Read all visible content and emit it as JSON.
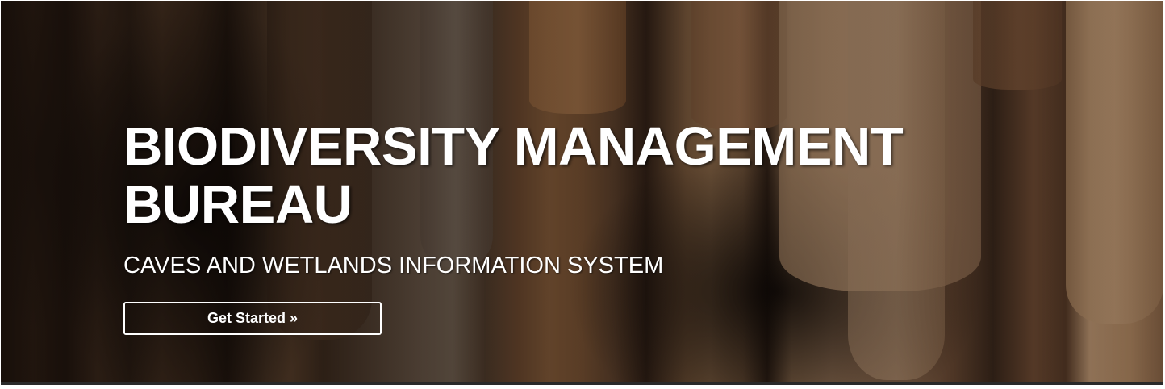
{
  "hero": {
    "title": "BIODIVERSITY MANAGEMENT BUREAU",
    "subtitle": "CAVES AND WETLANDS INFORMATION SYSTEM",
    "cta_label": "Get Started »",
    "background_image": "cave-stalactites-photo",
    "colors": {
      "text": "#ffffff",
      "button_border": "#ffffff",
      "overlay": "#000000"
    }
  }
}
